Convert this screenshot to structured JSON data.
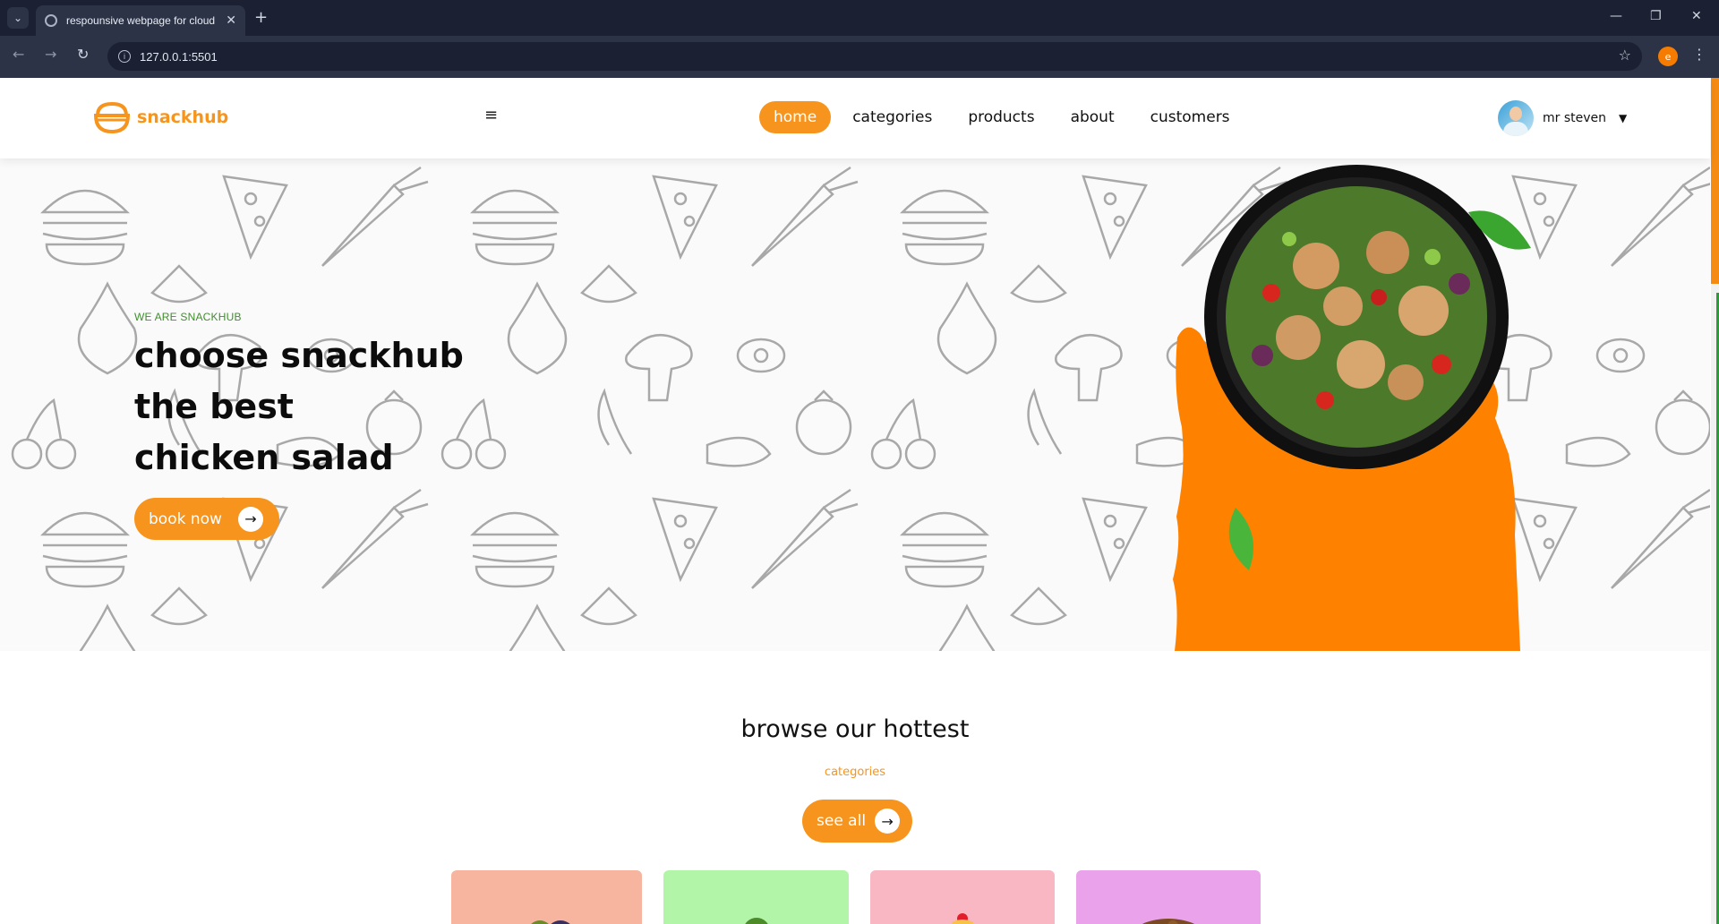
{
  "browser": {
    "tab_title": "respounsive webpage for cloud",
    "url": "127.0.0.1:5501",
    "profile_initial": "e"
  },
  "header": {
    "logo_text": "snackhub",
    "nav": [
      {
        "label": "home",
        "active": true
      },
      {
        "label": "categories",
        "active": false
      },
      {
        "label": "products",
        "active": false
      },
      {
        "label": "about",
        "active": false
      },
      {
        "label": "customers",
        "active": false
      }
    ],
    "user_name": "mr steven"
  },
  "hero": {
    "eyebrow": "WE ARE SNACKHUB",
    "headline_lines": [
      "choose snackhub",
      "the best",
      "chicken salad"
    ],
    "button_label": "book now"
  },
  "categories_section": {
    "title": "browse our hottest",
    "subtitle": "categories",
    "see_all_label": "see all"
  },
  "colors": {
    "brand_orange": "#f7941d",
    "accent_green": "#3f8f2c"
  }
}
